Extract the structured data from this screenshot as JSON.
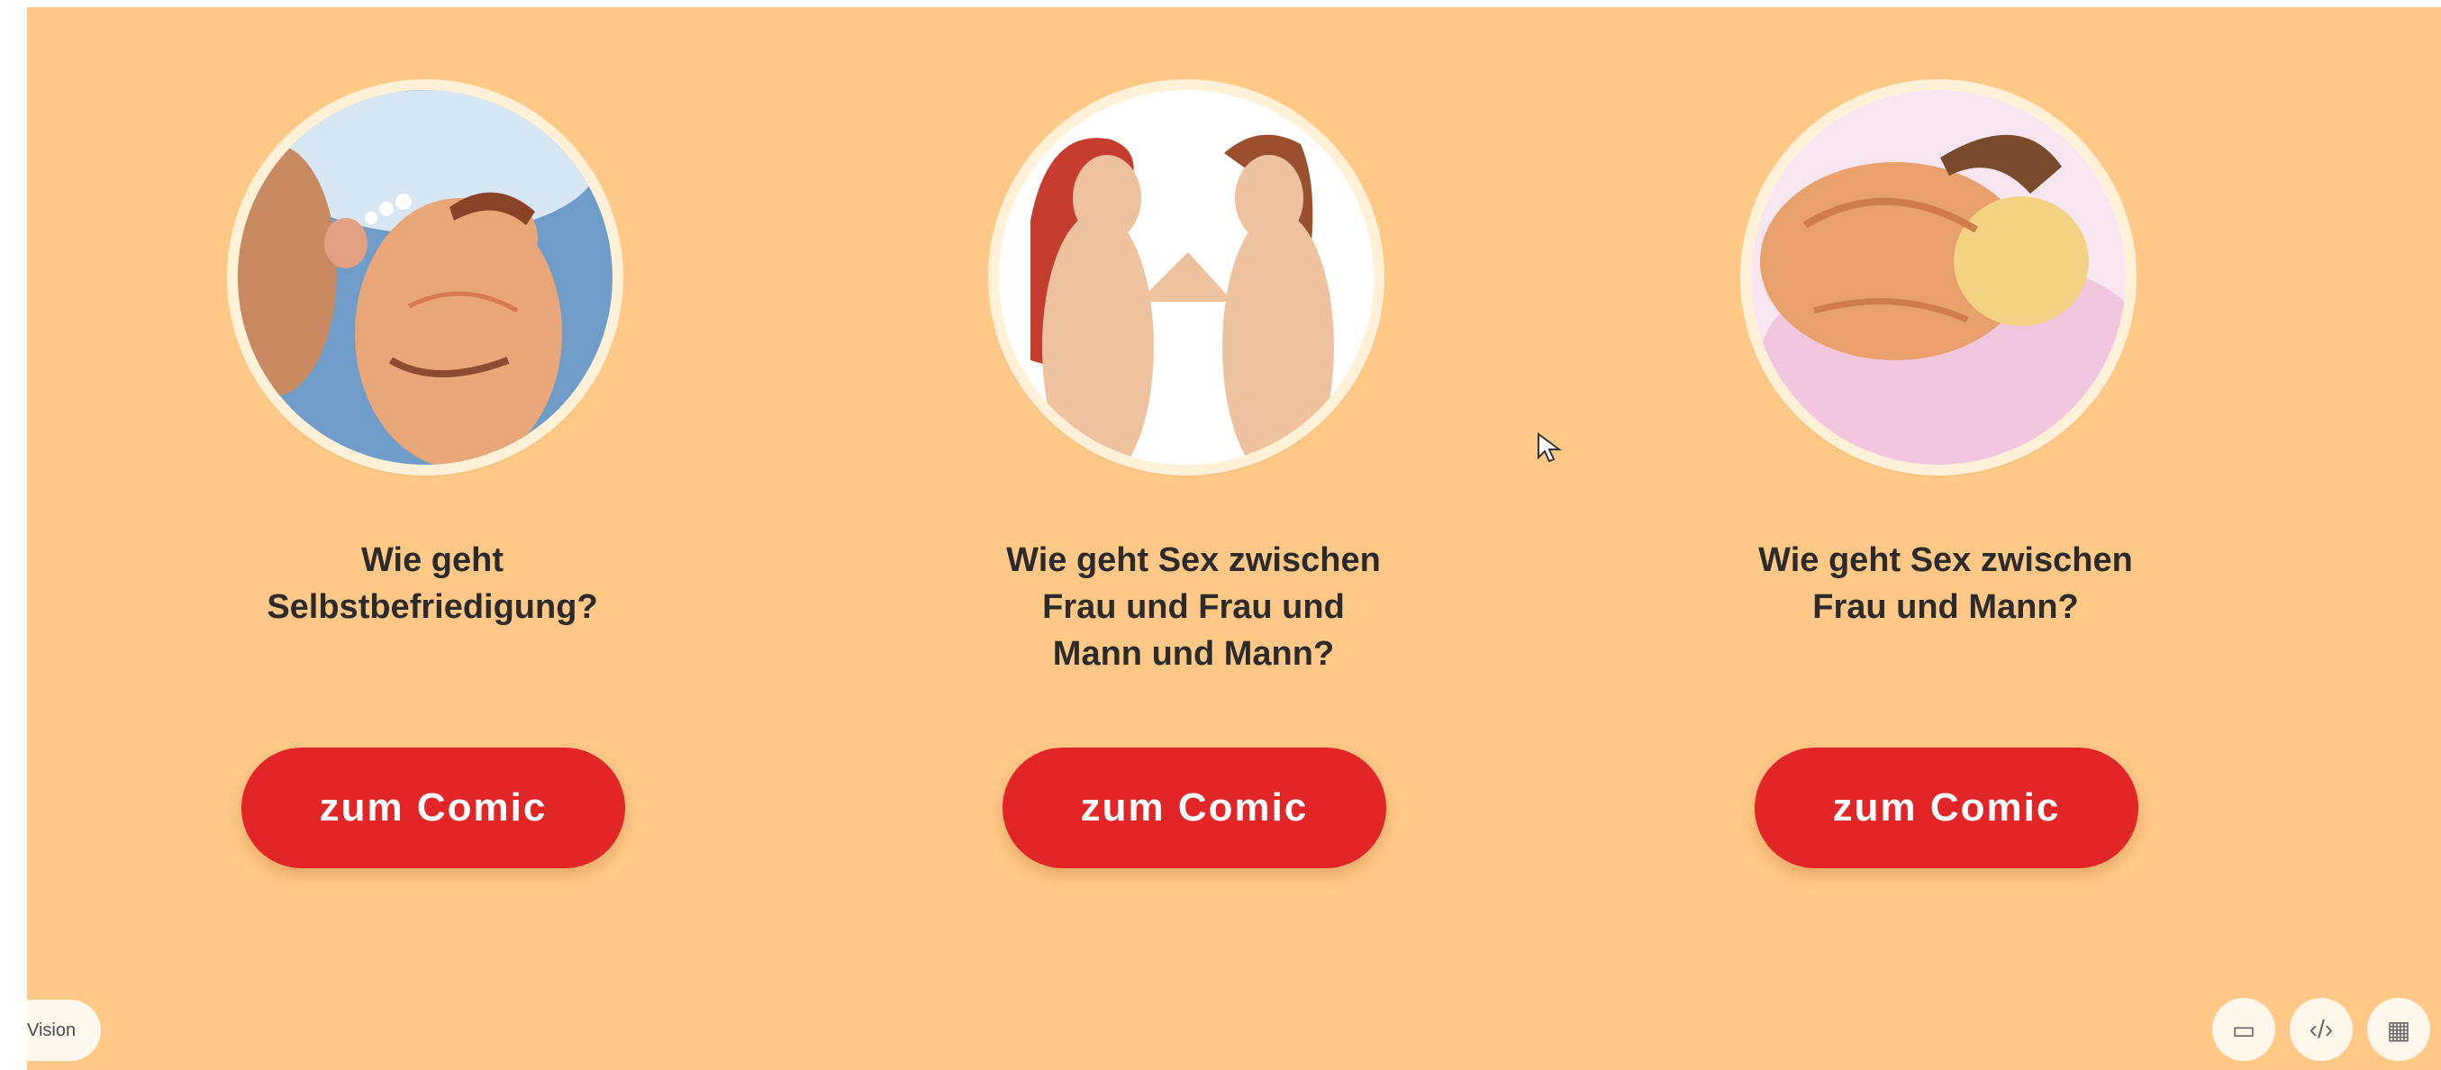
{
  "cards": [
    {
      "question": "Wie geht\nSelbstbefriedigung?",
      "button_label": "zum Comic"
    },
    {
      "question": "Wie geht Sex zwischen\nFrau und Frau und\nMann und Mann?",
      "button_label": "zum Comic"
    },
    {
      "question": "Wie geht Sex zwischen\nFrau und Mann?",
      "button_label": "zum Comic"
    }
  ],
  "footer": {
    "vision_label": "Vision",
    "tools": [
      "chat-icon",
      "code-icon",
      "grid-icon"
    ]
  },
  "colors": {
    "background": "#ffc886",
    "button": "#e22526",
    "image_frame": "#fff1d8",
    "text": "#2b2b2b"
  }
}
